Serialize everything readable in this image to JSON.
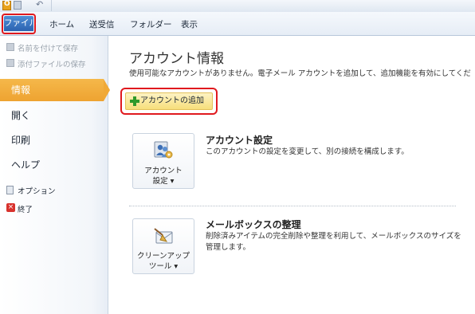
{
  "tabs": {
    "file": "ファイル",
    "home": "ホーム",
    "send_receive": "送受信",
    "folder": "フォルダー",
    "view": "表示"
  },
  "nav": {
    "save_as": "名前を付けて保存",
    "save_attachments": "添付ファイルの保存",
    "info": "情報",
    "open": "開く",
    "print": "印刷",
    "help": "ヘルプ",
    "options": "オプション",
    "exit": "終了"
  },
  "main": {
    "title": "アカウント情報",
    "description": "使用可能なアカウントがありません。電子メール アカウントを追加して、追加機能を有効にしてくだ",
    "add_account": "アカウントの追加",
    "account_settings": {
      "button_line1": "アカウント",
      "button_line2": "設定 ▾",
      "title": "アカウント設定",
      "description": "このアカウントの設定を変更して、別の接続を構成します。"
    },
    "cleanup": {
      "button_line1": "クリーンアップ",
      "button_line2": "ツール ▾",
      "title": "メールボックスの整理",
      "description": "削除済みアイテムの完全削除や整理を利用して、メールボックスのサイズを管理します。"
    }
  },
  "colors": {
    "file_tab": "#2b62b0",
    "active_nav": "#eea331",
    "highlight_box": "#e0191e"
  }
}
